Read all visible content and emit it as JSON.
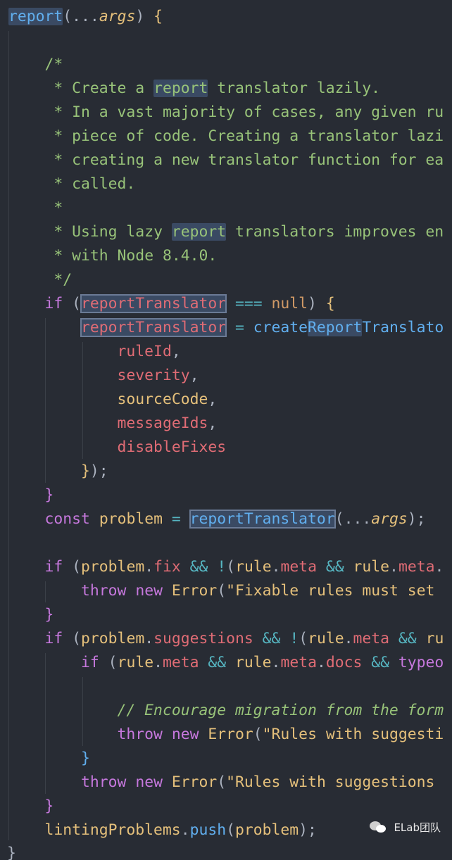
{
  "code": {
    "lines": [
      {
        "tokens": [
          [
            "f hl",
            "report"
          ],
          [
            "p",
            "("
          ],
          [
            "p",
            "..."
          ],
          [
            "a",
            "args"
          ],
          [
            "p",
            ")"
          ],
          [
            "p",
            " "
          ],
          [
            "y",
            "{"
          ]
        ]
      },
      {
        "tokens": []
      },
      {
        "tokens": [
          [
            "p",
            "    "
          ],
          [
            "c",
            "/*"
          ]
        ]
      },
      {
        "tokens": [
          [
            "p",
            "     "
          ],
          [
            "c",
            "* Create a "
          ],
          [
            "c hl",
            "report"
          ],
          [
            "c",
            " translator lazily."
          ]
        ]
      },
      {
        "tokens": [
          [
            "p",
            "     "
          ],
          [
            "c",
            "* In a vast majority of cases, any given ru"
          ]
        ]
      },
      {
        "tokens": [
          [
            "p",
            "     "
          ],
          [
            "c",
            "* piece of code. Creating a translator lazi"
          ]
        ]
      },
      {
        "tokens": [
          [
            "p",
            "     "
          ],
          [
            "c",
            "* creating a new translator function for ea"
          ]
        ]
      },
      {
        "tokens": [
          [
            "p",
            "     "
          ],
          [
            "c",
            "* called."
          ]
        ]
      },
      {
        "tokens": [
          [
            "p",
            "     "
          ],
          [
            "c",
            "*"
          ]
        ]
      },
      {
        "tokens": [
          [
            "p",
            "     "
          ],
          [
            "c",
            "* Using lazy "
          ],
          [
            "c hl",
            "report"
          ],
          [
            "c",
            " translators improves en"
          ]
        ]
      },
      {
        "tokens": [
          [
            "p",
            "     "
          ],
          [
            "c",
            "* with Node 8.4.0."
          ]
        ]
      },
      {
        "tokens": [
          [
            "p",
            "     "
          ],
          [
            "c",
            "*/"
          ]
        ]
      },
      {
        "tokens": [
          [
            "p",
            "    "
          ],
          [
            "k",
            "if"
          ],
          [
            "p",
            " ("
          ],
          [
            "v hl-box",
            "reportTranslator"
          ],
          [
            "p",
            " "
          ],
          [
            "o",
            "==="
          ],
          [
            "p",
            " "
          ],
          [
            "n",
            "null"
          ],
          [
            "p",
            ") "
          ],
          [
            "y",
            "{"
          ]
        ]
      },
      {
        "tokens": [
          [
            "p",
            "        "
          ],
          [
            "v hl-box",
            "reportTranslator"
          ],
          [
            "p",
            " "
          ],
          [
            "o",
            "="
          ],
          [
            "p",
            " "
          ],
          [
            "f",
            "create"
          ],
          [
            "f hl",
            "Report"
          ],
          [
            "f",
            "Translato"
          ]
        ]
      },
      {
        "tokens": [
          [
            "p",
            "            "
          ],
          [
            "v",
            "ruleId"
          ],
          [
            "p",
            ","
          ]
        ]
      },
      {
        "tokens": [
          [
            "p",
            "            "
          ],
          [
            "v",
            "severity"
          ],
          [
            "p",
            ","
          ]
        ]
      },
      {
        "tokens": [
          [
            "p",
            "            "
          ],
          [
            "y",
            "sourceCode"
          ],
          [
            "p",
            ","
          ]
        ]
      },
      {
        "tokens": [
          [
            "p",
            "            "
          ],
          [
            "v",
            "messageIds"
          ],
          [
            "p",
            ","
          ]
        ]
      },
      {
        "tokens": [
          [
            "p",
            "            "
          ],
          [
            "v",
            "disableFixes"
          ]
        ]
      },
      {
        "tokens": [
          [
            "p",
            "        "
          ],
          [
            "y",
            "}"
          ],
          [
            "p",
            ");"
          ]
        ]
      },
      {
        "tokens": [
          [
            "p",
            "    "
          ],
          [
            "k",
            "}"
          ]
        ]
      },
      {
        "tokens": [
          [
            "p",
            "    "
          ],
          [
            "k",
            "const"
          ],
          [
            "p",
            " "
          ],
          [
            "y",
            "problem"
          ],
          [
            "p",
            " "
          ],
          [
            "o",
            "="
          ],
          [
            "p",
            " "
          ],
          [
            "f hl-box",
            "reportTranslator"
          ],
          [
            "p",
            "("
          ],
          [
            "p",
            "..."
          ],
          [
            "a",
            "args"
          ],
          [
            "p",
            ");"
          ]
        ]
      },
      {
        "tokens": []
      },
      {
        "tokens": [
          [
            "p",
            "    "
          ],
          [
            "k",
            "if"
          ],
          [
            "p",
            " ("
          ],
          [
            "y",
            "problem"
          ],
          [
            "p",
            "."
          ],
          [
            "v",
            "fix"
          ],
          [
            "p",
            " "
          ],
          [
            "o",
            "&&"
          ],
          [
            "p",
            " "
          ],
          [
            "o",
            "!"
          ],
          [
            "p",
            "("
          ],
          [
            "y",
            "rule"
          ],
          [
            "p",
            "."
          ],
          [
            "v",
            "meta"
          ],
          [
            "p",
            " "
          ],
          [
            "o",
            "&&"
          ],
          [
            "p",
            " "
          ],
          [
            "y",
            "rule"
          ],
          [
            "p",
            "."
          ],
          [
            "v",
            "meta"
          ],
          [
            "p",
            "."
          ]
        ]
      },
      {
        "tokens": [
          [
            "p",
            "        "
          ],
          [
            "k",
            "throw"
          ],
          [
            "p",
            " "
          ],
          [
            "k",
            "new"
          ],
          [
            "p",
            " "
          ],
          [
            "y",
            "Error"
          ],
          [
            "p",
            "("
          ],
          [
            "s",
            "\"Fixable rules must set "
          ]
        ]
      },
      {
        "tokens": [
          [
            "p",
            "    "
          ],
          [
            "k",
            "}"
          ]
        ]
      },
      {
        "tokens": [
          [
            "p",
            "    "
          ],
          [
            "k",
            "if"
          ],
          [
            "p",
            " ("
          ],
          [
            "y",
            "problem"
          ],
          [
            "p",
            "."
          ],
          [
            "v",
            "suggestions"
          ],
          [
            "p",
            " "
          ],
          [
            "o",
            "&&"
          ],
          [
            "p",
            " "
          ],
          [
            "o",
            "!"
          ],
          [
            "p",
            "("
          ],
          [
            "y",
            "rule"
          ],
          [
            "p",
            "."
          ],
          [
            "v",
            "meta"
          ],
          [
            "p",
            " "
          ],
          [
            "o",
            "&&"
          ],
          [
            "p",
            " "
          ],
          [
            "y",
            "ru"
          ]
        ]
      },
      {
        "tokens": [
          [
            "p",
            "        "
          ],
          [
            "k",
            "if"
          ],
          [
            "p",
            " ("
          ],
          [
            "y",
            "rule"
          ],
          [
            "p",
            "."
          ],
          [
            "v",
            "meta"
          ],
          [
            "p",
            " "
          ],
          [
            "o",
            "&&"
          ],
          [
            "p",
            " "
          ],
          [
            "y",
            "rule"
          ],
          [
            "p",
            "."
          ],
          [
            "v",
            "meta"
          ],
          [
            "p",
            "."
          ],
          [
            "v",
            "docs"
          ],
          [
            "p",
            " "
          ],
          [
            "o",
            "&&"
          ],
          [
            "p",
            " "
          ],
          [
            "k",
            "typeo"
          ]
        ]
      },
      {
        "tokens": []
      },
      {
        "tokens": [
          [
            "p",
            "            "
          ],
          [
            "ci",
            "// Encourage migration from the form"
          ]
        ]
      },
      {
        "tokens": [
          [
            "p",
            "            "
          ],
          [
            "k",
            "throw"
          ],
          [
            "p",
            " "
          ],
          [
            "k",
            "new"
          ],
          [
            "p",
            " "
          ],
          [
            "y",
            "Error"
          ],
          [
            "p",
            "("
          ],
          [
            "s",
            "\"Rules with suggesti"
          ]
        ]
      },
      {
        "tokens": [
          [
            "p",
            "        "
          ],
          [
            "f",
            "}"
          ]
        ]
      },
      {
        "tokens": [
          [
            "p",
            "        "
          ],
          [
            "k",
            "throw"
          ],
          [
            "p",
            " "
          ],
          [
            "k",
            "new"
          ],
          [
            "p",
            " "
          ],
          [
            "y",
            "Error"
          ],
          [
            "p",
            "("
          ],
          [
            "s",
            "\"Rules with suggestions "
          ]
        ]
      },
      {
        "tokens": [
          [
            "p",
            "    "
          ],
          [
            "k",
            "}"
          ]
        ]
      },
      {
        "tokens": [
          [
            "p",
            "    "
          ],
          [
            "y",
            "lintingProblems"
          ],
          [
            "p",
            "."
          ],
          [
            "f",
            "push"
          ],
          [
            "p",
            "("
          ],
          [
            "y",
            "problem"
          ],
          [
            "p",
            ");"
          ]
        ]
      }
    ],
    "closing_brace": "}"
  },
  "watermark": {
    "icon": "wechat-icon",
    "label": "ELab团队"
  },
  "colors": {
    "background": "#282c34",
    "keyword": "#c678dd",
    "function": "#61afef",
    "property": "#e06c75",
    "identifier": "#e5c07b",
    "comment": "#98c379",
    "operator": "#56b6c2",
    "highlight": "#3a4a63"
  }
}
